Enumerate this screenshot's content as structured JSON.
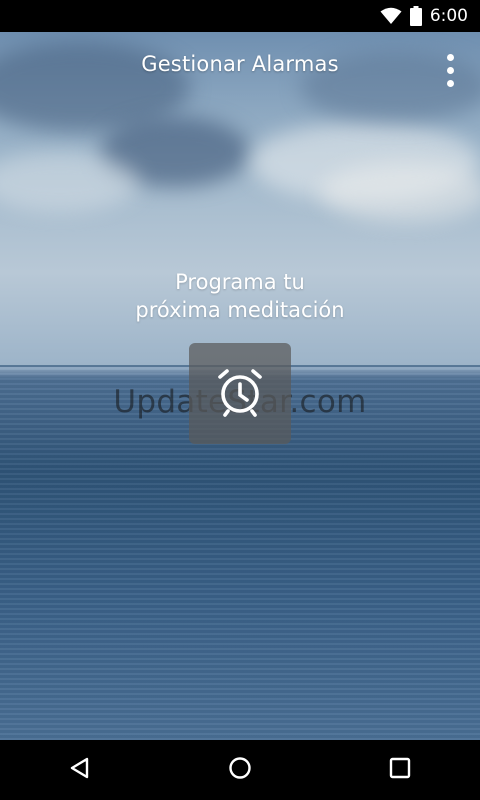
{
  "status_bar": {
    "time": "6:00",
    "icons": [
      "wifi-icon",
      "battery-icon"
    ]
  },
  "app_bar": {
    "title": "Gestionar Alarmas",
    "menu_icon": "more-vert-icon"
  },
  "main": {
    "prompt_line1": "Programa tu",
    "prompt_line2": "próxima meditación",
    "alarm_button_icon": "alarm-clock-icon",
    "watermark": "UpdateStar.com"
  },
  "nav_bar": {
    "icons": [
      "back-icon",
      "home-icon",
      "recents-icon"
    ]
  },
  "colors": {
    "status_bar_bg": "#000000",
    "nav_bar_bg": "#000000",
    "text": "#ffffff",
    "button_bg": "#5a5a5a"
  }
}
